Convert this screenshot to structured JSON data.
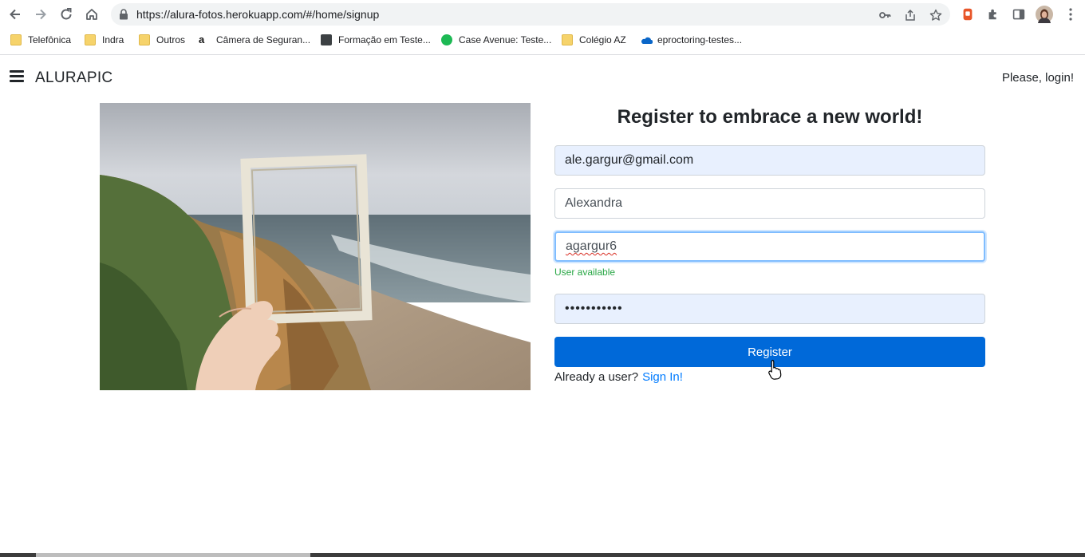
{
  "browser": {
    "url": "https://alura-fotos.herokuapp.com/#/home/signup",
    "bookmarks": [
      {
        "label": "Telefônica",
        "icon": "folder-icon"
      },
      {
        "label": "Indra",
        "icon": "folder-icon"
      },
      {
        "label": "Outros",
        "icon": "folder-icon"
      },
      {
        "label": "Câmera de Seguran...",
        "icon": "amazon-icon"
      },
      {
        "label": "Formação em Teste...",
        "icon": "course-icon"
      },
      {
        "label": "Case Avenue: Teste...",
        "icon": "spotify-icon"
      },
      {
        "label": "Colégio AZ",
        "icon": "folder-icon"
      },
      {
        "label": "eproctoring-testes...",
        "icon": "onedrive-icon"
      }
    ]
  },
  "header": {
    "brand": "ALURAPIC",
    "login_text": "Please, login!"
  },
  "form": {
    "title": "Register to embrace a new world!",
    "email_value": "ale.gargur@gmail.com",
    "fullname_value": "Alexandra",
    "username_value": "agargur6",
    "username_hint": "User available",
    "password_value": "•••••••••••",
    "register_label": "Register",
    "already_text": "Already a user?",
    "signin_label": "Sign In!"
  },
  "colors": {
    "primary": "#0069d9",
    "link": "#007bff",
    "success": "#28a745",
    "autofill": "#e8f0fe"
  }
}
